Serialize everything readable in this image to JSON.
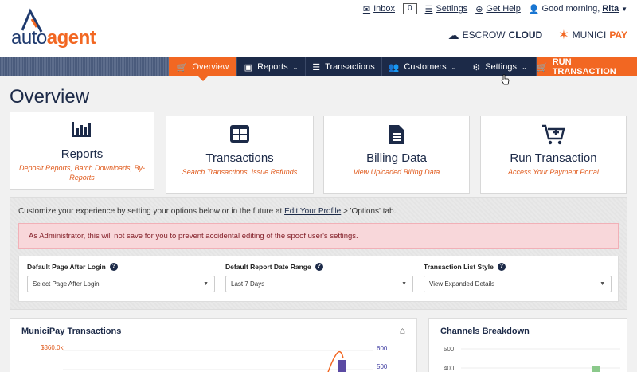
{
  "header": {
    "logo": {
      "part1": "auto",
      "part2": "agent"
    },
    "inbox_label": "Inbox",
    "inbox_count": "0",
    "settings_label": "Settings",
    "help_label": "Get Help",
    "greeting": "Good morning,",
    "user_name": "Rita",
    "brands": {
      "escrow_part1": "ESCROW",
      "escrow_part2": "CLOUD",
      "munici_part1": "MUNICI",
      "munici_part2": "PAY"
    }
  },
  "nav": {
    "overview": "Overview",
    "reports": "Reports",
    "transactions": "Transactions",
    "customers": "Customers",
    "settings": "Settings",
    "run": "RUN TRANSACTION"
  },
  "page_title": "Overview",
  "cards": [
    {
      "title": "Reports",
      "sub": "Deposit Reports, Batch Downloads, By-Reports",
      "icon": "bar-chart-icon"
    },
    {
      "title": "Transactions",
      "sub": "Search Transactions, Issue Refunds",
      "icon": "table-icon"
    },
    {
      "title": "Billing Data",
      "sub": "View Uploaded Billing Data",
      "icon": "document-icon"
    },
    {
      "title": "Run Transaction",
      "sub": "Access Your Payment Portal",
      "icon": "cart-icon"
    }
  ],
  "options_panel": {
    "intro_pre": "Customize your experience by setting your options below or in the future at",
    "intro_link": "Edit Your Profile",
    "intro_post": "> 'Options' tab.",
    "alert": "As Administrator, this will not save for you to prevent accidental editing of the spoof user's settings.",
    "fields": [
      {
        "label": "Default Page After Login",
        "value": "Select Page After Login"
      },
      {
        "label": "Default Report Date Range",
        "value": "Last 7 Days"
      },
      {
        "label": "Transaction List Style",
        "value": "View Expanded Details"
      }
    ]
  },
  "widgets": {
    "munici_title": "MuniciPay Transactions",
    "munici_left_tick": "$360.0k",
    "munici_right_ticks": [
      "600",
      "500"
    ],
    "channels_title": "Channels Breakdown",
    "channels_ticks": [
      "500",
      "400"
    ]
  },
  "colors": {
    "navy": "#1c2a48",
    "orange": "#f26722"
  }
}
